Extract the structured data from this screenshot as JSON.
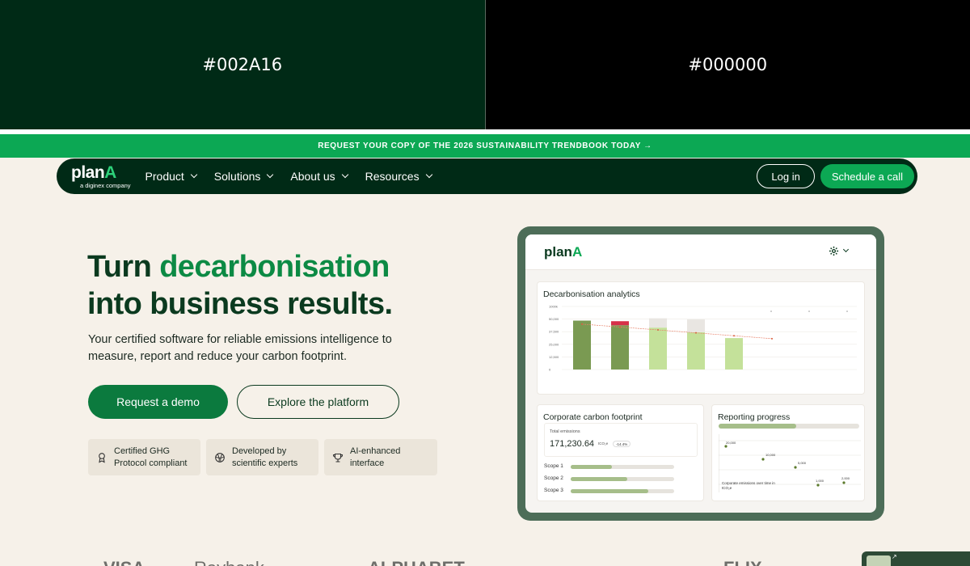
{
  "swatches": [
    {
      "label": "#002A16",
      "color": "#002A16"
    },
    {
      "label": "#000000",
      "color": "#000000"
    }
  ],
  "banner": {
    "text": "REQUEST YOUR COPY OF THE 2026 SUSTAINABILITY TRENDBOOK TODAY →"
  },
  "nav": {
    "logo": "planA",
    "logo_sub": "a diginex company",
    "items": [
      "Product",
      "Solutions",
      "About us",
      "Resources"
    ],
    "login": "Log in",
    "cta": "Schedule a call"
  },
  "hero": {
    "title_1": "Turn",
    "title_highlight": "decarbonisation",
    "title_2": "into business results.",
    "subtitle": "Your certified software for reliable emissions intelligence to measure, report and reduce your carbon footprint.",
    "btn_primary": "Request a demo",
    "btn_secondary": "Explore the platform"
  },
  "badges": [
    {
      "line1": "Certified GHG",
      "line2": "Protocol compliant",
      "icon": "award-icon"
    },
    {
      "line1": "Developed by",
      "line2": "scientific experts",
      "icon": "globe-icon"
    },
    {
      "line1": "AI-enhanced",
      "line2": "interface",
      "icon": "trophy-icon"
    }
  ],
  "mockup": {
    "logo": "planA",
    "analytics_title": "Decarbonisation analytics",
    "footprint_title": "Corporate carbon footprint",
    "total_label": "Total emissions",
    "total_value": "171,230.64",
    "total_unit": "tCO₂e",
    "total_change": "-14.4%",
    "scopes": [
      {
        "label": "Scope 1",
        "fill": 0.4
      },
      {
        "label": "Scope 2",
        "fill": 0.55
      },
      {
        "label": "Scope 3",
        "fill": 0.75
      }
    ],
    "reporting_title": "Reporting progress",
    "reporting_fill": 0.55,
    "reporting_legend": "Corporate emissions over time in tCO₂e",
    "reporting_values": [
      "20,000",
      "10,000",
      "5,000",
      "1,000",
      "2,000"
    ]
  },
  "chart_data": {
    "type": "bar",
    "title": "Decarbonisation analytics",
    "y_ticks": [
      "1000k",
      "50,000",
      "37,500",
      "25,000",
      "12,500",
      "0"
    ],
    "ylim": [
      0,
      50000
    ],
    "bars": [
      {
        "value": 42000,
        "color": "#7a9a52",
        "cap": 0,
        "cap_color": ""
      },
      {
        "value": 38000,
        "color": "#7a9a52",
        "cap": 3500,
        "cap_color": "#d63049"
      },
      {
        "value": 36000,
        "color": "#c4e19a",
        "cap": 8000,
        "cap_color": "#e9e6e2"
      },
      {
        "value": 32000,
        "color": "#c4e19a",
        "cap": 11000,
        "cap_color": "#e9e6e2"
      },
      {
        "value": 27000,
        "color": "#c4e19a",
        "cap": 0,
        "cap_color": ""
      }
    ],
    "trend": [
      39000,
      36500,
      34000,
      31500,
      29000,
      26500
    ]
  },
  "partners": [
    "VISA",
    "Raybank",
    "ALPHABET",
    "FLIX"
  ]
}
